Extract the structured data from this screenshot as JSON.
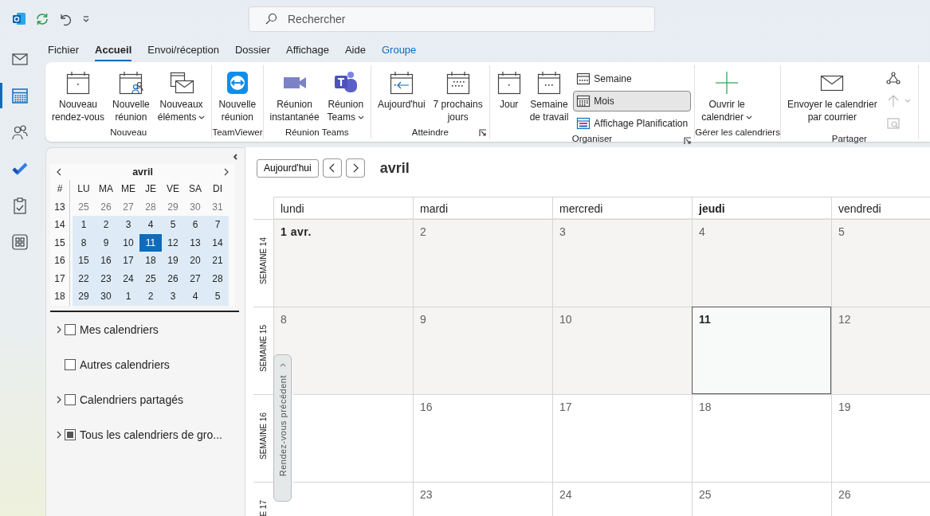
{
  "search": {
    "placeholder": "Rechercher"
  },
  "rail": [
    {
      "selected": false
    },
    {
      "selected": true
    },
    {
      "selected": false
    },
    {
      "selected": false
    },
    {
      "selected": false
    },
    {
      "selected": false
    }
  ],
  "tabs": [
    {
      "label": "Fichier",
      "selected": false,
      "contextual": false
    },
    {
      "label": "Accueil",
      "selected": true,
      "contextual": false
    },
    {
      "label": "Envoi/réception",
      "selected": false,
      "contextual": false
    },
    {
      "label": "Dossier",
      "selected": false,
      "contextual": false
    },
    {
      "label": "Affichage",
      "selected": false,
      "contextual": false
    },
    {
      "label": "Aide",
      "selected": false,
      "contextual": false
    },
    {
      "label": "Groupe",
      "selected": false,
      "contextual": true
    }
  ],
  "ribbon": [
    {
      "label": "Nouveau",
      "launcher": false,
      "buttons": [
        {
          "kind": "large",
          "label": "Nouveau\nrendez-vous",
          "dropdown": false
        },
        {
          "kind": "large",
          "label": "Nouvelle\nréunion",
          "dropdown": false
        },
        {
          "kind": "large",
          "label": "Nouveaux\néléments",
          "dropdown": true
        }
      ]
    },
    {
      "label": "TeamViewer",
      "launcher": false,
      "buttons": [
        {
          "kind": "large",
          "label": "Nouvelle\nréunion",
          "dropdown": false
        }
      ]
    },
    {
      "label": "Réunion Teams",
      "launcher": false,
      "buttons": [
        {
          "kind": "large",
          "label": "Réunion\ninstantanée",
          "dropdown": false
        },
        {
          "kind": "large",
          "label": "Réunion\nTeams",
          "dropdown": true
        }
      ]
    },
    {
      "label": "Atteindre",
      "launcher": true,
      "buttons": [
        {
          "kind": "large",
          "label": "Aujourd'hui",
          "dropdown": false
        },
        {
          "kind": "large",
          "label": "7 prochains\njours",
          "dropdown": false
        }
      ]
    },
    {
      "label": "Organiser",
      "launcher": true,
      "buttons": [
        {
          "kind": "large",
          "label": "Jour",
          "dropdown": false,
          "selected": false
        },
        {
          "kind": "large",
          "label": "Semaine\nde travail",
          "dropdown": false,
          "selected": false
        },
        {
          "kind": "small",
          "label": "Semaine",
          "dropdown": false,
          "selected": false
        },
        {
          "kind": "small",
          "label": "Mois",
          "dropdown": false,
          "selected": true
        },
        {
          "kind": "small",
          "label": "Affichage Planification",
          "dropdown": false,
          "selected": false
        }
      ]
    },
    {
      "label": "Gérer les calendriers",
      "launcher": false,
      "buttons": [
        {
          "kind": "large",
          "label": "Ouvrir le\ncalendrier",
          "dropdown": true
        }
      ]
    },
    {
      "label": "Partager",
      "launcher": false,
      "buttons": [
        {
          "kind": "large",
          "label": "Envoyer le calendrier\npar courrier",
          "dropdown": false
        },
        {
          "kind": "icon",
          "dropdown": false,
          "disabled": false
        },
        {
          "kind": "icon",
          "dropdown": true,
          "disabled": true
        },
        {
          "kind": "icon",
          "dropdown": false,
          "disabled": true
        }
      ]
    }
  ],
  "mini_calendar": {
    "title": "avril",
    "week_header": "#",
    "weekdays": [
      "LU",
      "MA",
      "ME",
      "JE",
      "VE",
      "SA",
      "DI"
    ],
    "weeks": [
      {
        "number": "13",
        "in_view": false,
        "days": [
          {
            "day": "25",
            "other_month": true,
            "selected": false
          },
          {
            "day": "26",
            "other_month": true,
            "selected": false
          },
          {
            "day": "27",
            "other_month": true,
            "selected": false
          },
          {
            "day": "28",
            "other_month": true,
            "selected": false
          },
          {
            "day": "29",
            "other_month": true,
            "selected": false
          },
          {
            "day": "30",
            "other_month": true,
            "selected": false
          },
          {
            "day": "31",
            "other_month": true,
            "selected": false
          }
        ]
      },
      {
        "number": "14",
        "in_view": true,
        "days": [
          {
            "day": "1",
            "other_month": false,
            "selected": false
          },
          {
            "day": "2",
            "other_month": false,
            "selected": false
          },
          {
            "day": "3",
            "other_month": false,
            "selected": false
          },
          {
            "day": "4",
            "other_month": false,
            "selected": false
          },
          {
            "day": "5",
            "other_month": false,
            "selected": false
          },
          {
            "day": "6",
            "other_month": false,
            "selected": false
          },
          {
            "day": "7",
            "other_month": false,
            "selected": false
          }
        ]
      },
      {
        "number": "15",
        "in_view": true,
        "days": [
          {
            "day": "8",
            "other_month": false,
            "selected": false
          },
          {
            "day": "9",
            "other_month": false,
            "selected": false
          },
          {
            "day": "10",
            "other_month": false,
            "selected": false
          },
          {
            "day": "11",
            "other_month": false,
            "selected": true
          },
          {
            "day": "12",
            "other_month": false,
            "selected": false
          },
          {
            "day": "13",
            "other_month": false,
            "selected": false
          },
          {
            "day": "14",
            "other_month": false,
            "selected": false
          }
        ]
      },
      {
        "number": "16",
        "in_view": true,
        "days": [
          {
            "day": "15",
            "other_month": false,
            "selected": false
          },
          {
            "day": "16",
            "other_month": false,
            "selected": false
          },
          {
            "day": "17",
            "other_month": false,
            "selected": false
          },
          {
            "day": "18",
            "other_month": false,
            "selected": false
          },
          {
            "day": "19",
            "other_month": false,
            "selected": false
          },
          {
            "day": "20",
            "other_month": false,
            "selected": false
          },
          {
            "day": "21",
            "other_month": false,
            "selected": false
          }
        ]
      },
      {
        "number": "17",
        "in_view": true,
        "days": [
          {
            "day": "22",
            "other_month": false,
            "selected": false
          },
          {
            "day": "23",
            "other_month": false,
            "selected": false
          },
          {
            "day": "24",
            "other_month": false,
            "selected": false
          },
          {
            "day": "25",
            "other_month": false,
            "selected": false
          },
          {
            "day": "26",
            "other_month": false,
            "selected": false
          },
          {
            "day": "27",
            "other_month": false,
            "selected": false
          },
          {
            "day": "28",
            "other_month": false,
            "selected": false
          }
        ]
      },
      {
        "number": "18",
        "in_view": true,
        "days": [
          {
            "day": "29",
            "other_month": false,
            "selected": false
          },
          {
            "day": "30",
            "other_month": false,
            "selected": false
          },
          {
            "day": "1",
            "other_month": false,
            "selected": false
          },
          {
            "day": "2",
            "other_month": false,
            "selected": false
          },
          {
            "day": "3",
            "other_month": false,
            "selected": false
          },
          {
            "day": "4",
            "other_month": false,
            "selected": false
          },
          {
            "day": "5",
            "other_month": false,
            "selected": false
          }
        ]
      }
    ]
  },
  "folders": [
    {
      "label": "Mes calendriers",
      "expandable": true,
      "checked": false,
      "mixed": false
    },
    {
      "label": "Autres calendriers",
      "expandable": false,
      "checked": false,
      "mixed": false
    },
    {
      "label": "Calendriers partagés",
      "expandable": true,
      "checked": false,
      "mixed": false
    },
    {
      "label": "Tous les calendriers de gro...",
      "expandable": true,
      "checked": false,
      "mixed": true
    }
  ],
  "calendar": {
    "today_button": "Aujourd'hui",
    "title": "avril",
    "columns": [
      {
        "label": "lundi",
        "today": false
      },
      {
        "label": "mardi",
        "today": false
      },
      {
        "label": "mercredi",
        "today": false
      },
      {
        "label": "jeudi",
        "today": true
      },
      {
        "label": "vendredi",
        "today": false
      }
    ],
    "weeks": [
      {
        "label": "SEMAINE 14",
        "shaded": true,
        "days": [
          {
            "date": "1 avr.",
            "month_start": true,
            "today": false
          },
          {
            "date": "2",
            "month_start": false,
            "today": false
          },
          {
            "date": "3",
            "month_start": false,
            "today": false
          },
          {
            "date": "4",
            "month_start": false,
            "today": false
          },
          {
            "date": "5",
            "month_start": false,
            "today": false
          }
        ]
      },
      {
        "label": "SEMAINE 15",
        "shaded": true,
        "days": [
          {
            "date": "8",
            "month_start": false,
            "today": false
          },
          {
            "date": "9",
            "month_start": false,
            "today": false
          },
          {
            "date": "10",
            "month_start": false,
            "today": false
          },
          {
            "date": "11",
            "month_start": false,
            "today": true
          },
          {
            "date": "12",
            "month_start": false,
            "today": false
          }
        ]
      },
      {
        "label": "SEMAINE 16",
        "shaded": false,
        "days": [
          {
            "today": false
          },
          {
            "date": "16",
            "month_start": false,
            "today": false
          },
          {
            "date": "17",
            "month_start": false,
            "today": false
          },
          {
            "date": "18",
            "month_start": false,
            "today": false
          },
          {
            "date": "19",
            "month_start": false,
            "today": false
          }
        ]
      },
      {
        "label": "E 17",
        "shaded": false,
        "days": [
          {
            "today": false
          },
          {
            "date": "23",
            "month_start": false,
            "today": false
          },
          {
            "date": "24",
            "month_start": false,
            "today": false
          },
          {
            "date": "25",
            "month_start": false,
            "today": false
          },
          {
            "date": "26",
            "month_start": false,
            "today": false
          }
        ]
      }
    ],
    "previous_tab": "Rendez-vous précédent"
  }
}
